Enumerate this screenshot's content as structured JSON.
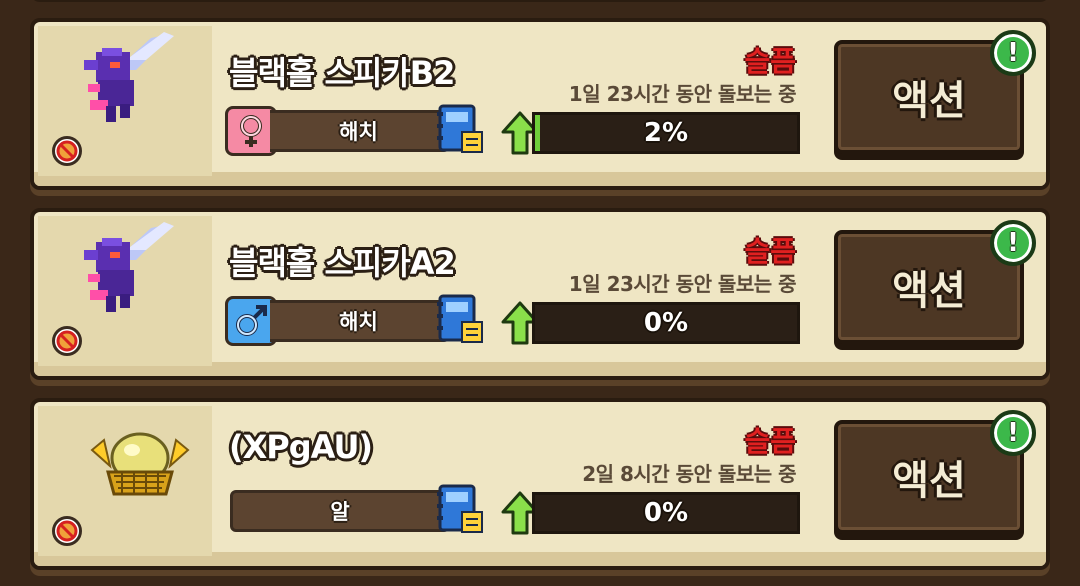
{
  "ui": {
    "action_label": "액션",
    "alert_symbol": "!",
    "colors": {
      "grade": "#e02020",
      "progress_fill": "#6fcf3a",
      "alert": "#3cb84a"
    }
  },
  "creatures": [
    {
      "name": "블랙홀 스피카B2",
      "grade": "슬픔",
      "care_time": "1일 23시간 동안 돌보는 중",
      "gender": "female",
      "gender_icon": "female-symbol-icon",
      "state": "해치",
      "progress_label": "2%",
      "progress": 0.02
    },
    {
      "name": "블랙홀 스피카A2",
      "grade": "슬픔",
      "care_time": "1일 23시간 동안 돌보는 중",
      "gender": "male",
      "gender_icon": "male-symbol-icon",
      "state": "해치",
      "progress_label": "0%",
      "progress": 0.0
    },
    {
      "name": "(XPgAU)",
      "grade": "슬픔",
      "care_time": "2일 8시간 동안 돌보는 중",
      "gender": null,
      "state": "알",
      "progress_label": "0%",
      "progress": 0.0
    }
  ]
}
